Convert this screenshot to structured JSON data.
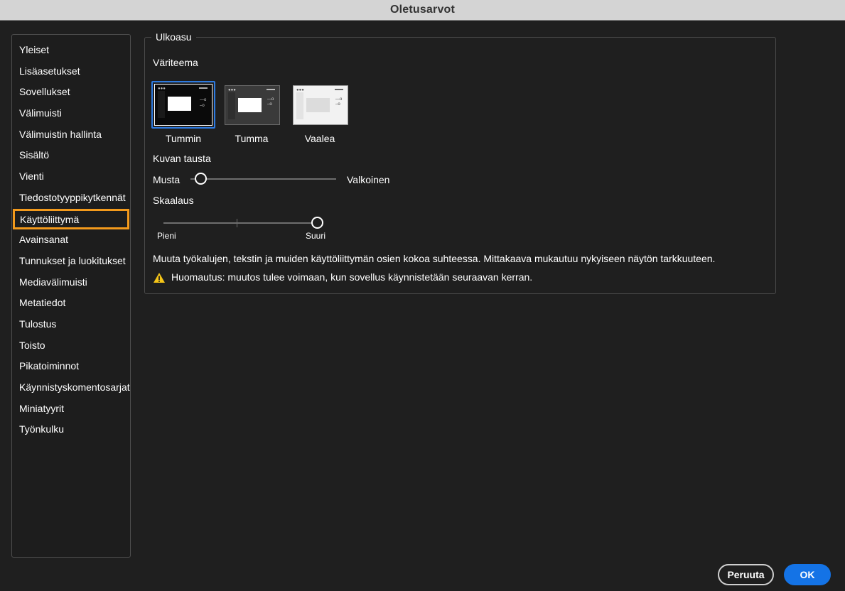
{
  "window": {
    "title": "Oletusarvot"
  },
  "sidebar": {
    "items": [
      {
        "label": "Yleiset"
      },
      {
        "label": "Lisäasetukset"
      },
      {
        "label": "Sovellukset"
      },
      {
        "label": "Välimuisti"
      },
      {
        "label": "Välimuistin hallinta"
      },
      {
        "label": "Sisältö"
      },
      {
        "label": "Vienti"
      },
      {
        "label": "Tiedostotyyppikytkennät"
      },
      {
        "label": "Käyttöliittymä",
        "selected": true
      },
      {
        "label": "Avainsanat"
      },
      {
        "label": "Tunnukset ja luokitukset"
      },
      {
        "label": "Mediavälimuisti"
      },
      {
        "label": "Metatiedot"
      },
      {
        "label": "Tulostus"
      },
      {
        "label": "Toisto"
      },
      {
        "label": "Pikatoiminnot"
      },
      {
        "label": "Käynnistyskomentosarjat"
      },
      {
        "label": "Miniatyyrit"
      },
      {
        "label": "Työnkulku"
      }
    ],
    "highlight_color": "#f39a1c"
  },
  "appearance": {
    "legend": "Ulkoasu",
    "color_theme_label": "Väriteema",
    "themes": [
      {
        "label": "Tummin",
        "selected": true
      },
      {
        "label": "Tumma",
        "selected": false
      },
      {
        "label": "Vaalea",
        "selected": false
      }
    ],
    "image_background": {
      "label": "Kuvan tausta",
      "min_label": "Musta",
      "max_label": "Valkoinen",
      "value_fraction": 0.07
    },
    "scaling": {
      "label": "Skaalaus",
      "min_label": "Pieni",
      "max_label": "Suuri",
      "value_fraction": 1.0
    },
    "description": "Muuta työkalujen, tekstin ja muiden käyttöliittymän osien kokoa suhteessa. Mittakaava mukautuu nykyiseen näytön tarkkuuteen.",
    "warning_icon": "warning-icon",
    "note": "Huomautus: muutos tulee voimaan, kun sovellus käynnistetään seuraavan kerran."
  },
  "buttons": {
    "cancel": "Peruuta",
    "ok": "OK"
  },
  "colors": {
    "accent": "#1473e6",
    "warning": "#f5c518"
  }
}
